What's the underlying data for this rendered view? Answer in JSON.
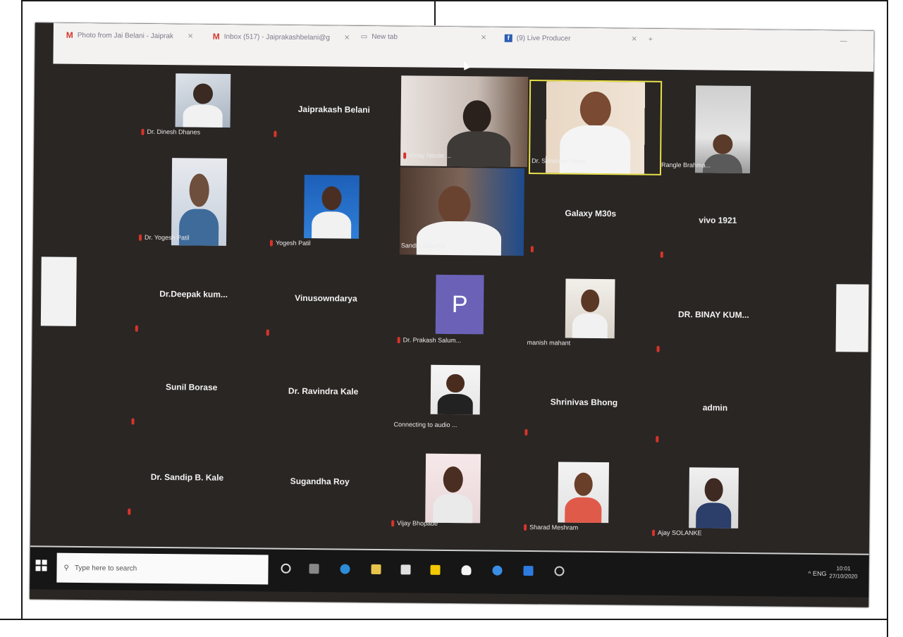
{
  "browser": {
    "tabs": [
      {
        "label": "Photo from Jai Belani - Jaiprak",
        "icon": "gmail-icon"
      },
      {
        "label": "Inbox (517) - Jaiprakashbelani@g",
        "icon": "gmail-icon"
      },
      {
        "label": "New tab",
        "icon": "newtab-icon"
      },
      {
        "label": "(9) Live Producer",
        "icon": "facebook-icon"
      }
    ],
    "new_tab_symbol": "+",
    "minimize_symbol": "—"
  },
  "participants": [
    {
      "name": "Dr. Dinesh Dhanes",
      "kind": "photo"
    },
    {
      "name": "Jaiprakash Belani",
      "kind": "name"
    },
    {
      "name": "Vinay Nikole ...",
      "kind": "video"
    },
    {
      "name": "Dr. Sahebrao Ahire",
      "kind": "video"
    },
    {
      "name": "Rangle Brahma...",
      "kind": "photo"
    },
    {
      "name": "Dr. Yogesh Patil",
      "kind": "photo"
    },
    {
      "name": "Yogesh Patil",
      "kind": "photo"
    },
    {
      "name": "Sandip Salunke",
      "kind": "video"
    },
    {
      "name": "Galaxy M30s",
      "kind": "name"
    },
    {
      "name": "vivo 1921",
      "kind": "name"
    },
    {
      "name": "Dr.Deepak kum...",
      "kind": "name"
    },
    {
      "name": "Vinusowndarya",
      "kind": "name"
    },
    {
      "name": "Dr. Prakash Salum...",
      "kind": "avatar",
      "initial": "P"
    },
    {
      "name": "manish mahant",
      "kind": "photo"
    },
    {
      "name": "DR. BINAY KUM...",
      "kind": "name"
    },
    {
      "name": "Sunil Borase",
      "kind": "name"
    },
    {
      "name": "Dr. Ravindra Kale",
      "kind": "name"
    },
    {
      "name": "Connecting to audio ...",
      "kind": "photo"
    },
    {
      "name": "Shrinivas Bhong",
      "kind": "name"
    },
    {
      "name": "admin",
      "kind": "name"
    },
    {
      "name": "Dr. Sandip B. Kale",
      "kind": "name"
    },
    {
      "name": "Sugandha Roy",
      "kind": "name"
    },
    {
      "name": "Vijay Bhopade",
      "kind": "photo"
    },
    {
      "name": "Sharad Meshram",
      "kind": "photo"
    },
    {
      "name": "Ajay SOLANKE",
      "kind": "photo"
    }
  ],
  "taskbar": {
    "search_placeholder": "Type here to search",
    "tray_text": "^  ENG",
    "clock_time": "10:01",
    "clock_date": "27/10/2020"
  },
  "colors": {
    "meeting_bg": "#2a2624",
    "muted_mic": "#d8342a",
    "avatar_purple": "#6b62b8",
    "active_speaker_border": "#e8e04a"
  }
}
